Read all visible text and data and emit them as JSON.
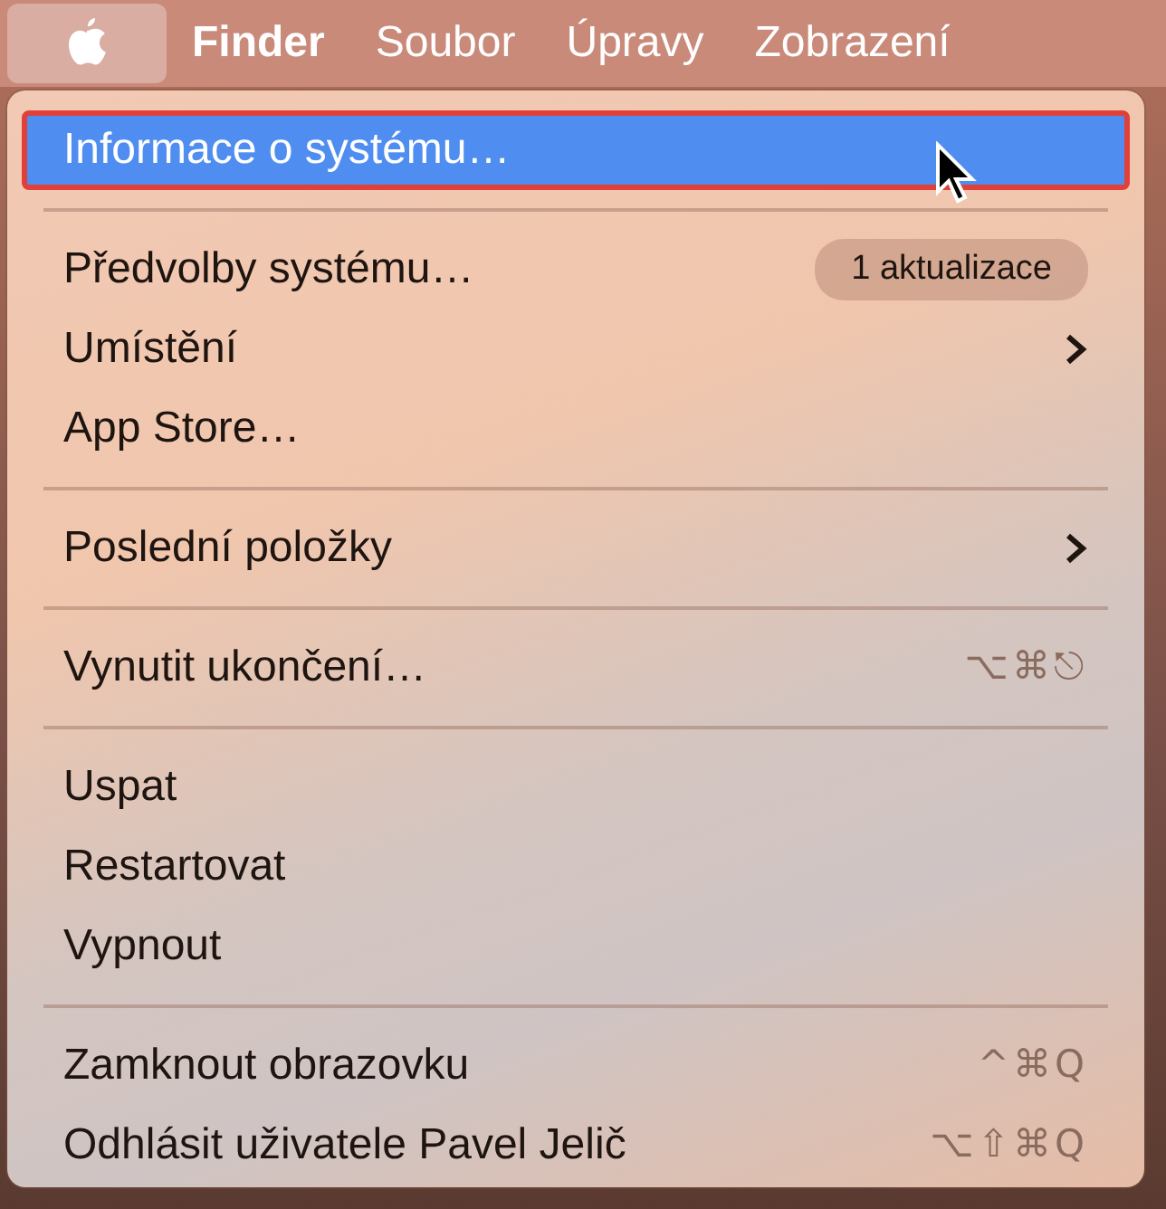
{
  "menu_bar": {
    "items": [
      {
        "kind": "apple",
        "selected": true
      },
      {
        "kind": "app",
        "label": "Finder",
        "selected": false
      },
      {
        "kind": "menu",
        "label": "Soubor",
        "selected": false
      },
      {
        "kind": "menu",
        "label": "Úpravy",
        "selected": false
      },
      {
        "kind": "menu",
        "label": "Zobrazení",
        "selected": false
      }
    ]
  },
  "menu": {
    "sections": [
      {
        "items": [
          {
            "label": "Informace o systému…",
            "selected": true
          }
        ]
      },
      {
        "items": [
          {
            "label": "Předvolby systému…",
            "selected": false,
            "badge": "1 aktualizace"
          },
          {
            "label": "Umístění",
            "selected": false,
            "submenu": true
          },
          {
            "label": "App Store…",
            "selected": false
          }
        ]
      },
      {
        "items": [
          {
            "label": "Poslední položky",
            "selected": false,
            "submenu": true
          }
        ]
      },
      {
        "items": [
          {
            "label": "Vynutit ukončení…",
            "selected": false,
            "shortcut": "⌥⌘⎋"
          }
        ]
      },
      {
        "items": [
          {
            "label": "Uspat",
            "selected": false
          },
          {
            "label": "Restartovat",
            "selected": false
          },
          {
            "label": "Vypnout",
            "selected": false
          }
        ]
      },
      {
        "items": [
          {
            "label": "Zamknout obrazovku",
            "selected": false,
            "shortcut": "^⌘Q"
          },
          {
            "label": "Odhlásit uživatele Pavel Jelič",
            "selected": false,
            "shortcut": "⌥⇧⌘Q"
          }
        ]
      }
    ]
  }
}
